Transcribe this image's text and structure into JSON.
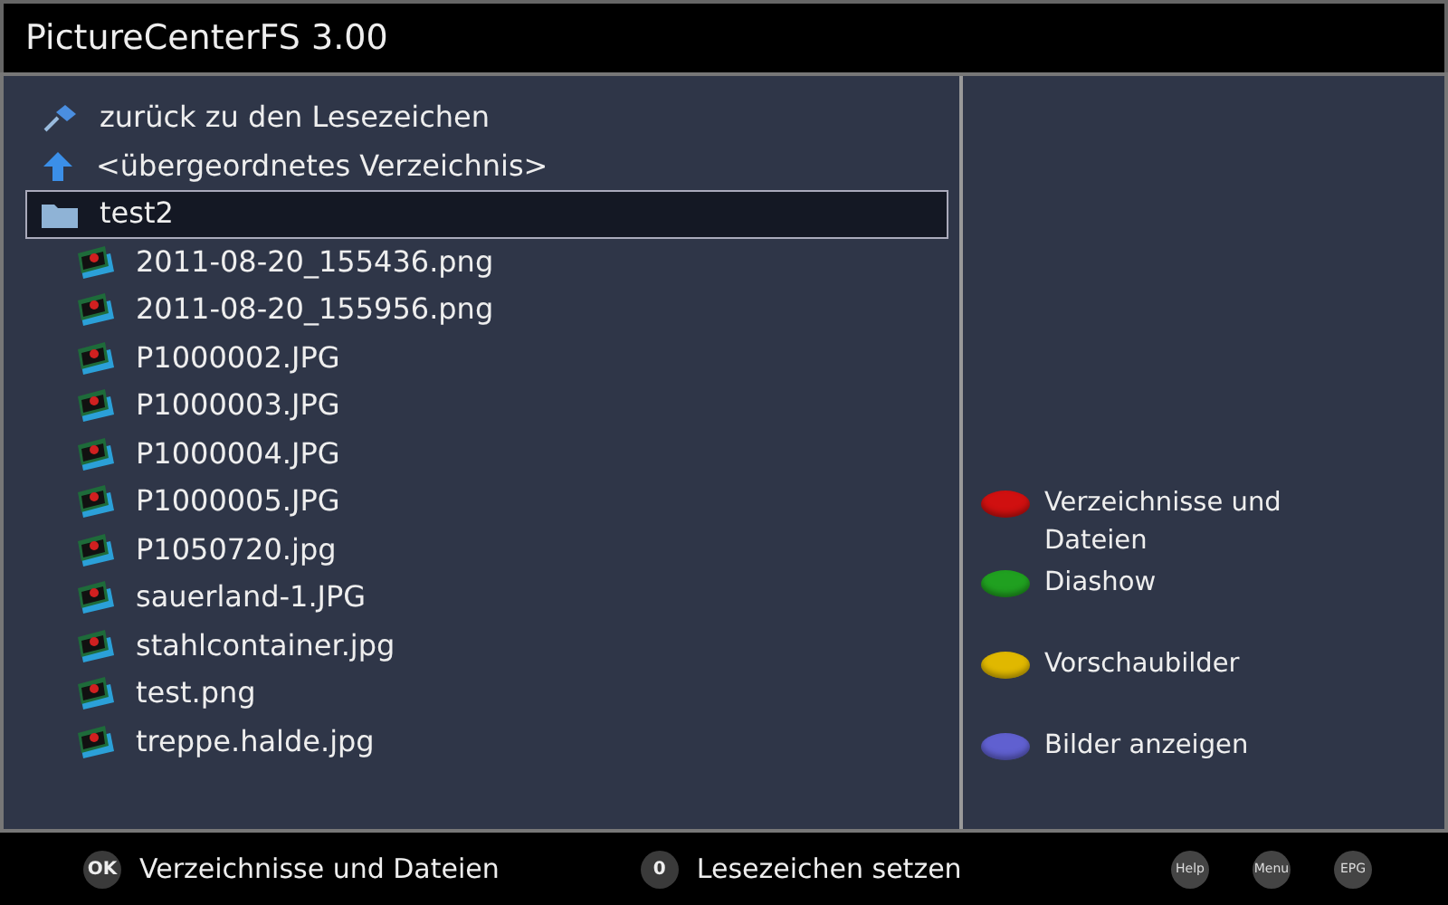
{
  "window": {
    "title": "PictureCenterFS 3.00"
  },
  "file_list": [
    {
      "kind": "bookmark",
      "label": "zurück zu den Lesezeichen",
      "selected": false
    },
    {
      "kind": "parent",
      "label": "<übergeordnetes Verzeichnis>",
      "selected": false
    },
    {
      "kind": "folder",
      "label": "test2",
      "selected": true,
      "children": [
        {
          "kind": "image",
          "label": "2011-08-20_155436.png",
          "selected": false
        },
        {
          "kind": "image",
          "label": "2011-08-20_155956.png",
          "selected": false
        },
        {
          "kind": "image",
          "label": "P1000002.JPG",
          "selected": false
        },
        {
          "kind": "image",
          "label": "P1000003.JPG",
          "selected": false
        },
        {
          "kind": "image",
          "label": "P1000004.JPG",
          "selected": false
        },
        {
          "kind": "image",
          "label": "P1000005.JPG",
          "selected": false
        },
        {
          "kind": "image",
          "label": "P1050720.jpg",
          "selected": false
        },
        {
          "kind": "image",
          "label": "sauerland-1.JPG",
          "selected": false
        },
        {
          "kind": "image",
          "label": "stahlcontainer.jpg",
          "selected": false
        },
        {
          "kind": "image",
          "label": "test.png",
          "selected": false
        },
        {
          "kind": "image",
          "label": "treppe.halde.jpg",
          "selected": false
        }
      ]
    }
  ],
  "color_keys": [
    {
      "color": "#d01010",
      "label": "Verzeichnisse und Dateien"
    },
    {
      "color": "#20a020",
      "label": "Diashow"
    },
    {
      "color": "#e0b800",
      "label": "Vorschaubilder"
    },
    {
      "color": "#6060d0",
      "label": "Bilder anzeigen"
    }
  ],
  "footer": {
    "keys": [
      {
        "key": "OK",
        "label": "Verzeichnisse und Dateien"
      },
      {
        "key": "0",
        "label": "Lesezeichen setzen"
      }
    ],
    "buttons": [
      "Help",
      "Menu",
      "EPG"
    ]
  }
}
